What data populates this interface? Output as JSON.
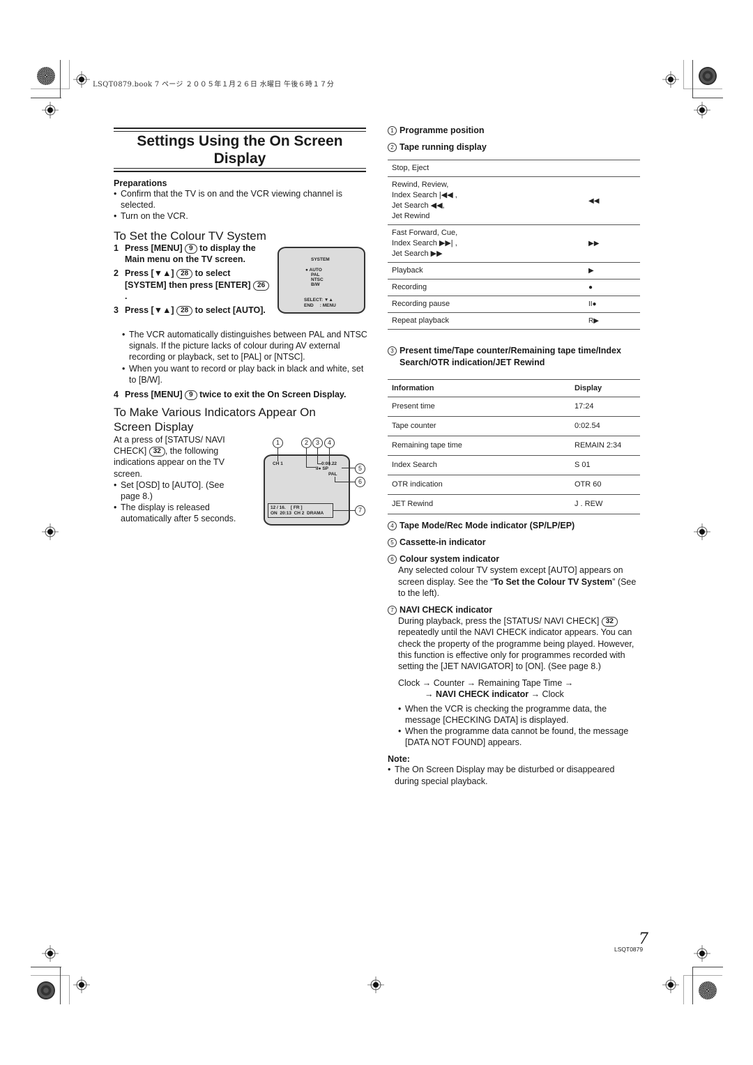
{
  "header_meta": "LSQT0879.book  7 ページ  ２００５年１月２６日  水曜日  午後６時１７分",
  "title": "Settings Using the On Screen Display",
  "title_line1": "Settings Using the On Screen",
  "title_line2": "Display",
  "preparations": {
    "heading": "Preparations",
    "bullets": [
      "Confirm that the TV is on and the VCR viewing channel is selected.",
      "Turn on the VCR."
    ]
  },
  "colour_system": {
    "heading": "To Set the Colour TV System",
    "steps": [
      {
        "num": "1",
        "pre": "Press [MENU] ",
        "badge": "9",
        "post": " to display the Main menu on the TV screen."
      },
      {
        "num": "2",
        "pre": "Press [▼▲] ",
        "badge": "28",
        "post": " to select [SYSTEM] then press [ENTER] ",
        "badge2": "26",
        "post2": "."
      },
      {
        "num": "3",
        "pre": "Press [▼▲] ",
        "badge": "28",
        "post": " to select [AUTO]."
      },
      {
        "num": "4",
        "pre": "Press [MENU] ",
        "badge": "9",
        "post": " twice to exit the On Screen Display."
      }
    ],
    "bullets": [
      "The VCR automatically distinguishes between PAL and NTSC signals. If the picture lacks of colour during AV external recording or playback, set to [PAL] or [NTSC].",
      "When you want to record or play back in black and white, set to [B/W]."
    ],
    "tv_menu": {
      "title": "SYSTEM",
      "options": [
        "AUTO",
        "PAL",
        "NTSC",
        "B/W"
      ],
      "selected": "AUTO",
      "select_hint": "SELECT: ▼▲",
      "end_hint": "END     : MENU"
    }
  },
  "indicators": {
    "heading_line1": "To Make Various Indicators Appear On",
    "heading_line2": "Screen Display",
    "intro_pre": "At a press of [STATUS/ NAVI CHECK] ",
    "intro_badge": "32",
    "intro_post": ", the following indications appear on the TV screen.",
    "bullets": [
      "Set [OSD] to [AUTO]. (See page 8.)",
      "The display is released automatically after 5 seconds."
    ],
    "tv_display": {
      "channel": "CH 1",
      "counter": "0:00.22",
      "mode": "II● SP",
      "colour": "PAL",
      "navi_line1": "12 / 16.    [ FR ]",
      "navi_line2": "ON  20:13  CH 2  DRAMA",
      "callouts": [
        "1",
        "2",
        "3",
        "4",
        "5",
        "6",
        "7"
      ]
    }
  },
  "right": {
    "item1": {
      "num": "1",
      "label": "Programme position"
    },
    "item2": {
      "num": "2",
      "label": "Tape running display"
    },
    "tape_table": [
      {
        "label": "Stop, Eject",
        "symbol": ""
      },
      {
        "label": "Rewind, Review,\nIndex Search |◀◀ ,\nJet Search ◀◀,\nJet Rewind",
        "symbol": "◀◀"
      },
      {
        "label": "Fast Forward, Cue,\nIndex Search ▶▶| ,\nJet Search ▶▶",
        "symbol": "▶▶"
      },
      {
        "label": "Playback",
        "symbol": "▶"
      },
      {
        "label": "Recording",
        "symbol": "●"
      },
      {
        "label": "Recording pause",
        "symbol": "II●"
      },
      {
        "label": "Repeat playback",
        "symbol": "R▶"
      }
    ],
    "item3": {
      "num": "3",
      "label": "Present time/Tape counter/Remaining tape time/Index Search/OTR indication/JET Rewind"
    },
    "info_table": {
      "headers": [
        "Information",
        "Display"
      ],
      "rows": [
        [
          "Present time",
          "17:24"
        ],
        [
          "Tape counter",
          "0:02.54"
        ],
        [
          "Remaining tape time",
          "REMAIN 2:34"
        ],
        [
          "Index Search",
          "S 01"
        ],
        [
          "OTR indication",
          "OTR 60"
        ],
        [
          "JET Rewind",
          "J . REW"
        ]
      ]
    },
    "item4": {
      "num": "4",
      "label": "Tape Mode/Rec Mode indicator (SP/LP/EP)"
    },
    "item5": {
      "num": "5",
      "label": "Cassette-in indicator"
    },
    "item6": {
      "num": "6",
      "label": "Colour system indicator",
      "body_pre": "Any selected colour TV system except [AUTO] appears on screen display. See the “",
      "body_bold": "To Set the Colour TV System",
      "body_post": "” (See to the left)."
    },
    "item7": {
      "num": "7",
      "label": "NAVI CHECK indicator",
      "body_pre": "During playback, press the [STATUS/ NAVI CHECK] ",
      "badge": "32",
      "body_post": " repeatedly until the NAVI CHECK indicator appears. You can check the property of the programme being played. However, this function is effective only for programmes recorded with setting the [JET NAVIGATOR] to [ON]. (See page 8.)"
    },
    "cycle_line1": "Clock → Counter → Remaining Tape Time →",
    "cycle_line2_pre": "→ ",
    "cycle_line2_bold": "NAVI CHECK indicator",
    "cycle_line2_post": " → Clock",
    "bullets": [
      "When the VCR is checking the programme data, the message [CHECKING DATA] is displayed.",
      "When the programme data cannot be found, the message [DATA NOT FOUND] appears."
    ],
    "note_heading": "Note:",
    "note_bullets": [
      "The On Screen Display may be disturbed or disappeared during special playback."
    ]
  },
  "footer": {
    "page_number": "7",
    "code": "LSQT0879"
  }
}
